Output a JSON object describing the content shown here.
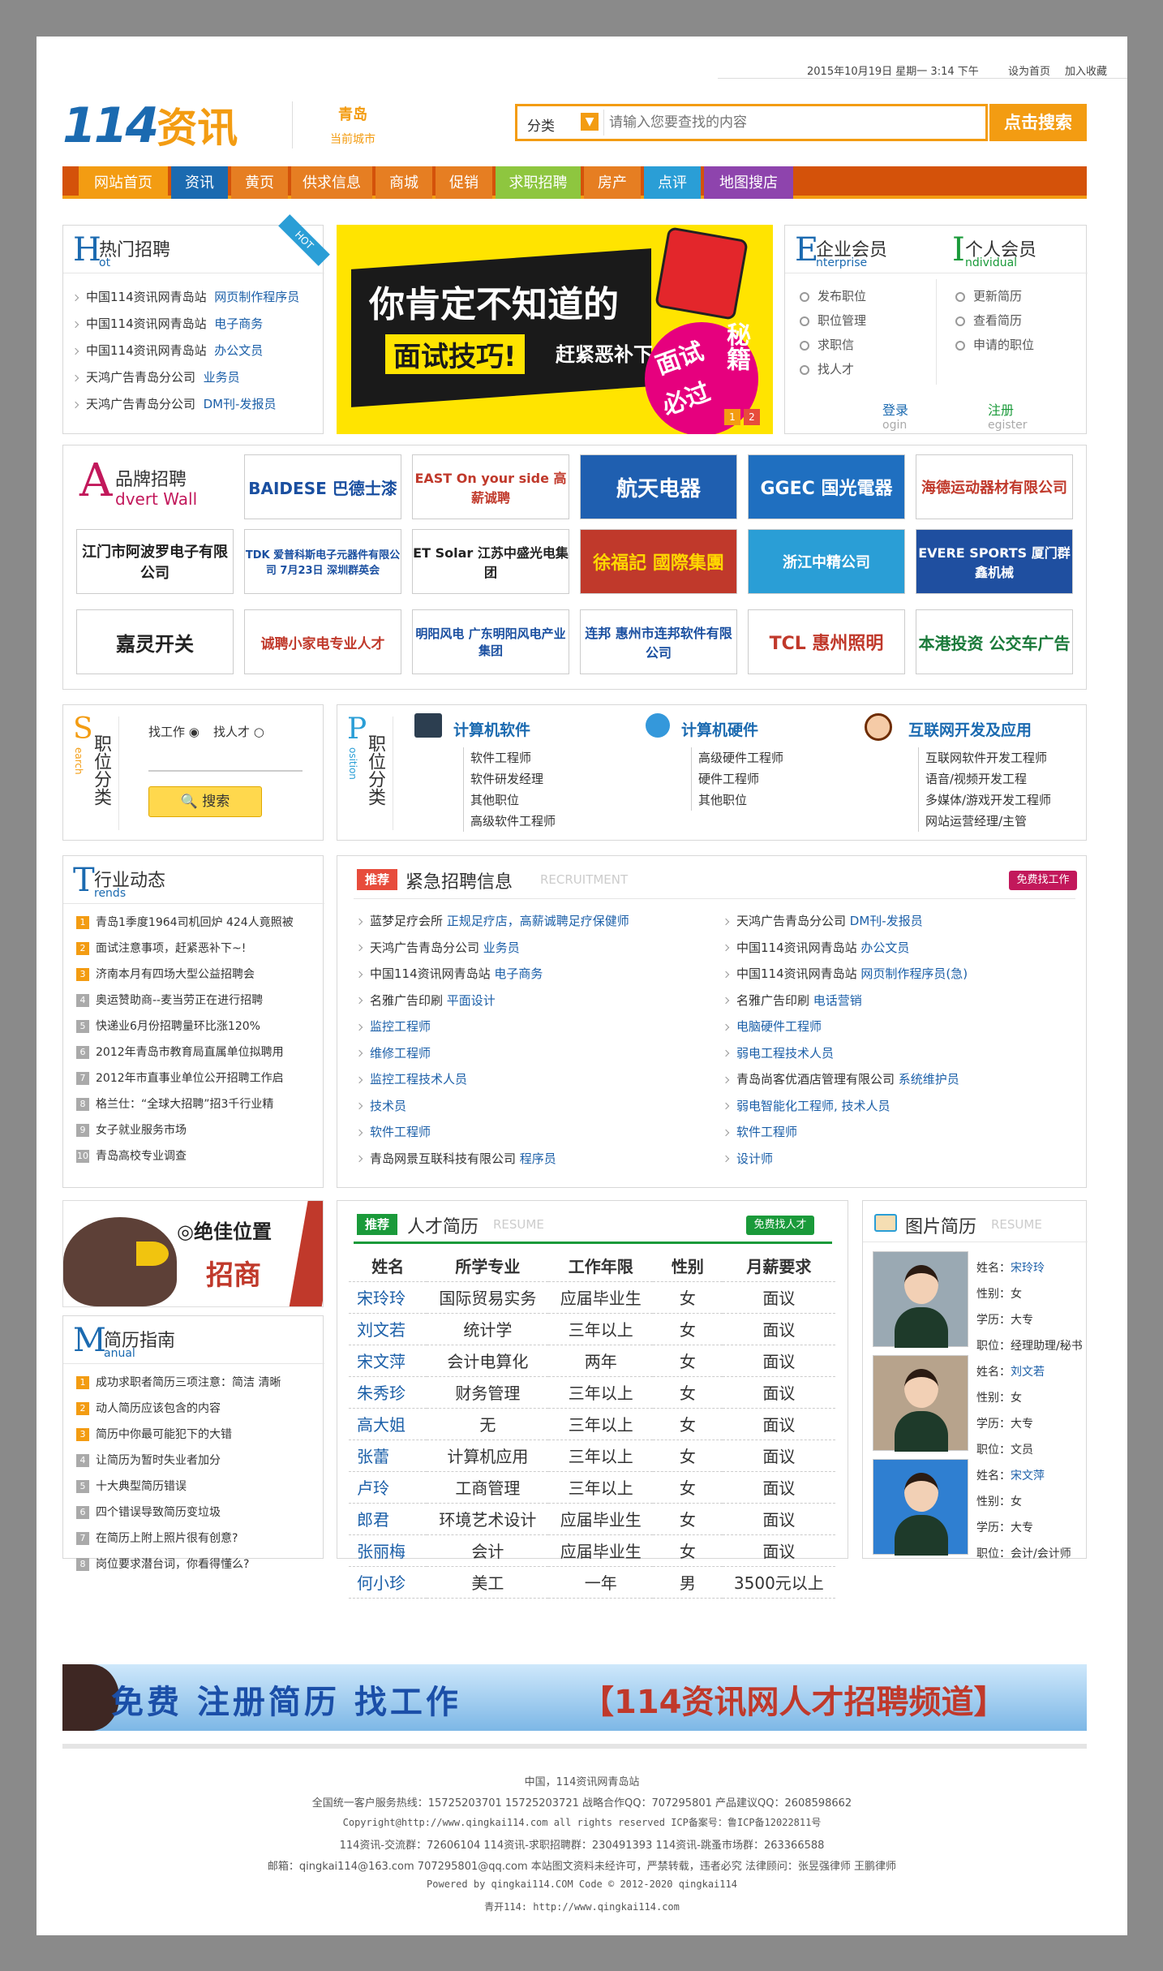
{
  "topbar": {
    "datetime": "2015年10月19日 星期一 3:14 下午",
    "set_home": "设为首页",
    "add_fav": "加入收藏"
  },
  "header": {
    "logo_num": "114",
    "logo_text": "资讯",
    "city": "青岛",
    "city_sub": "当前城市",
    "search_category": "分类",
    "search_placeholder": "请输入您要查找的内容",
    "search_button": "点击搜索"
  },
  "nav": [
    "网站首页",
    "资讯",
    "黄页",
    "供求信息",
    "商城",
    "促销",
    "求职招聘",
    "房产",
    "点评",
    "地图搜店"
  ],
  "hot": {
    "en_letter": "H",
    "title": "热门招聘",
    "en": "ot",
    "badge": "HOT",
    "items": [
      {
        "company": "中国114资讯网青岛站",
        "job": "网页制作程序员"
      },
      {
        "company": "中国114资讯网青岛站",
        "job": "电子商务"
      },
      {
        "company": "中国114资讯网青岛站",
        "job": "办公文员"
      },
      {
        "company": "天鸿广告青岛分公司",
        "job": "业务员"
      },
      {
        "company": "天鸿广告青岛分公司",
        "job": "DM刊-发报员"
      }
    ]
  },
  "banner": {
    "line1": "你肯定不知道的",
    "line2": "面试技巧!",
    "line3": "赶紧恶补下GO!",
    "side1": "面试",
    "side2": "秘籍",
    "side3": "必过",
    "pages": [
      "1",
      "2"
    ]
  },
  "members": {
    "ent_letter": "E",
    "ent_title": "企业会员",
    "ent_en": "nterprise",
    "ind_letter": "I",
    "ind_title": "个人会员",
    "ind_en": "ndividual",
    "ent_items": [
      "发布职位",
      "职位管理",
      "求职信",
      "找人才"
    ],
    "ind_items": [
      "更新简历",
      "查看简历",
      "申请的职位"
    ],
    "login": "登录",
    "login_en": "ogin",
    "register": "注册",
    "register_en": "egister"
  },
  "brands": {
    "label_cn": "品牌招聘",
    "label_en": "dvert Wall",
    "label_letter": "A",
    "tiles": [
      {
        "text": "BAIDESE 巴德士漆",
        "color": "#1a4fa0"
      },
      {
        "text": "EAST On your side 高薪诚聘",
        "color": "#c0392b"
      },
      {
        "text": "航天电器",
        "color": "#fff",
        "bg": "#1f5fb0"
      },
      {
        "text": "GGEC 国光電器",
        "color": "#fff",
        "bg": "#1f6fc0"
      },
      {
        "text": "海德运动器材有限公司",
        "color": "#c0392b"
      },
      {
        "text": "江门市阿波罗电子有限公司",
        "color": "#222"
      },
      {
        "text": "TDK 爱普科斯电子元器件有限公司 7月23日 深圳群英会",
        "color": "#1a4fa0"
      },
      {
        "text": "ET Solar 江苏中盛光电集团",
        "color": "#222"
      },
      {
        "text": "徐福記 國際集團",
        "color": "#ffd700",
        "bg": "#c0392b"
      },
      {
        "text": "浙江中精公司",
        "color": "#fff",
        "bg": "#2a9ed6"
      },
      {
        "text": "EVERE SPORTS 厦门群鑫机械",
        "color": "#fff",
        "bg": "#1f4fa0"
      },
      {
        "text": "嘉灵开关",
        "color": "#222"
      },
      {
        "text": "诚聘小家电专业人才",
        "color": "#c0392b"
      },
      {
        "text": "明阳风电 广东明阳风电产业集团",
        "color": "#1a4fa0"
      },
      {
        "text": "连邦 惠州市连邦软件有限公司",
        "color": "#1a4fa0"
      },
      {
        "text": "TCL 惠州照明",
        "color": "#c0392b"
      },
      {
        "text": "本港投资 公交车广告",
        "color": "#1a7a3a"
      }
    ]
  },
  "search_cat": {
    "letter": "S",
    "title": "职位分类",
    "en": "earch",
    "opt1": "找工作",
    "opt2": "找人才",
    "button": "搜索"
  },
  "position": {
    "letter": "P",
    "title": "职位分类",
    "en": "osition",
    "cols": [
      {
        "title": "计算机软件",
        "items": [
          "软件工程师",
          "软件研发经理",
          "其他职位",
          "高级软件工程师"
        ]
      },
      {
        "title": "计算机硬件",
        "items": [
          "高级硬件工程师",
          "硬件工程师",
          "其他职位"
        ]
      },
      {
        "title": "互联网开发及应用",
        "items": [
          "互联网软件开发工程师",
          "语音/视频开发工程",
          "多媒体/游戏开发工程师",
          "网站运营经理/主管"
        ]
      }
    ]
  },
  "trends": {
    "letter": "T",
    "title": "行业动态",
    "en": "rends",
    "items": [
      "青岛1季度1964司机回炉 424人竟照被",
      "面试注意事项，赶紧恶补下~!",
      "济南本月有四场大型公益招聘会",
      "奥运赞助商--麦当劳正在进行招聘",
      "快递业6月份招聘量环比涨120%",
      "2012年青岛市教育局直属单位拟聘用",
      "2012年市直事业单位公开招聘工作启",
      "格兰仕：“全球大招聘”招3千行业精",
      "女子就业服务市场",
      "青岛高校专业调查"
    ]
  },
  "urgent": {
    "tag": "推荐",
    "title": "紧急招聘信息",
    "en": "RECRUITMENT",
    "button": "免费找工作",
    "left": [
      {
        "c": "蓝梦足疗会所",
        "j": "正规足疗店，高薪诚聘足疗保健师"
      },
      {
        "c": "天鸿广告青岛分公司",
        "j": "业务员"
      },
      {
        "c": "中国114资讯网青岛站",
        "j": "电子商务"
      },
      {
        "c": "名雅广告印刷",
        "j": "平面设计"
      },
      {
        "c": "",
        "j": "监控工程师"
      },
      {
        "c": "",
        "j": "维修工程师"
      },
      {
        "c": "",
        "j": "监控工程技术人员"
      },
      {
        "c": "",
        "j": "技术员"
      },
      {
        "c": "",
        "j": "软件工程师"
      },
      {
        "c": "青岛网景互联科技有限公司",
        "j": "程序员"
      }
    ],
    "right": [
      {
        "c": "天鸿广告青岛分公司",
        "j": "DM刊-发报员"
      },
      {
        "c": "中国114资讯网青岛站",
        "j": "办公文员"
      },
      {
        "c": "中国114资讯网青岛站",
        "j": "网页制作程序员(急)"
      },
      {
        "c": "名雅广告印刷",
        "j": "电话营销"
      },
      {
        "c": "",
        "j": "电脑硬件工程师"
      },
      {
        "c": "",
        "j": "弱电工程技术人员"
      },
      {
        "c": "青岛尚客优酒店管理有限公司",
        "j": "系统维护员"
      },
      {
        "c": "",
        "j": "弱电智能化工程师, 技术人员"
      },
      {
        "c": "",
        "j": "软件工程师"
      },
      {
        "c": "",
        "j": "设计师"
      }
    ]
  },
  "adv": {
    "line1": "◎绝佳位置",
    "line2": "招商"
  },
  "manual": {
    "letter": "M",
    "title": "简历指南",
    "en": "anual",
    "items": [
      "成功求职者简历三项注意：简洁 清晰",
      "动人简历应该包含的内容",
      "简历中你最可能犯下的大错",
      "让简历为暂时失业者加分",
      "十大典型简历错误",
      "四个错误导致简历变垃圾",
      "在简历上附上照片很有创意?",
      "岗位要求潜台词，你看得懂么?"
    ]
  },
  "resume": {
    "tag": "推荐",
    "title": "人才简历",
    "en": "RESUME",
    "button": "免费找人才",
    "headers": [
      "姓名",
      "所学专业",
      "工作年限",
      "性别",
      "月薪要求"
    ],
    "rows": [
      [
        "宋玲玲",
        "国际贸易实务",
        "应届毕业生",
        "女",
        "面议"
      ],
      [
        "刘文若",
        "统计学",
        "三年以上",
        "女",
        "面议"
      ],
      [
        "宋文萍",
        "会计电算化",
        "两年",
        "女",
        "面议"
      ],
      [
        "朱秀珍",
        "财务管理",
        "三年以上",
        "女",
        "面议"
      ],
      [
        "高大姐",
        "无",
        "三年以上",
        "女",
        "面议"
      ],
      [
        "张蕾",
        "计算机应用",
        "三年以上",
        "女",
        "面议"
      ],
      [
        "卢玲",
        "工商管理",
        "三年以上",
        "女",
        "面议"
      ],
      [
        "郎君",
        "环境艺术设计",
        "应届毕业生",
        "女",
        "面议"
      ],
      [
        "张丽梅",
        "会计",
        "应届毕业生",
        "女",
        "面议"
      ],
      [
        "何小珍",
        "美工",
        "一年",
        "男",
        "3500元以上"
      ]
    ]
  },
  "photo": {
    "title": "图片简历",
    "en": "RESUME",
    "k_name": "姓名：",
    "k_gender": "性别：",
    "k_edu": "学历：",
    "k_pos": "职位：",
    "people": [
      {
        "name": "宋玲玲",
        "gender": "女",
        "edu": "大专",
        "pos": "经理助理/秘书"
      },
      {
        "name": "刘文若",
        "gender": "女",
        "edu": "大专",
        "pos": "文员"
      },
      {
        "name": "宋文萍",
        "gender": "女",
        "edu": "大专",
        "pos": "会计/会计师"
      }
    ]
  },
  "bottom_banner": {
    "left": "免费 注册简历 找工作",
    "right": "【114资讯网人才招聘频道】"
  },
  "footer": [
    "中国，114资讯网青岛站",
    "全国统一客户服务热线：15725203701 15725203721 战略合作QQ：707295801 产品建议QQ：2608598662",
    "Copyright@http://www.qingkai114.com all rights reserved ICP备案号：鲁ICP备12022811号",
    "114资讯-交流群：72606104 114资讯-求职招聘群：230491393 114资讯-跳蚤市场群：263366588",
    "邮箱：qingkai114@163.com 707295801@qq.com 本站图文资料未经许可，严禁转载，违者必究 法律顾问：张昱强律师 王鹏律师",
    "Powered by qingkai114.COM Code © 2012-2020 qingkai114",
    "青开114: http://www.qingkai114.com"
  ],
  "colors": {
    "orange": "#f39c12",
    "blue": "#1b6ab0",
    "nav_bg": "#d35400",
    "green": "#1a9a3a"
  }
}
